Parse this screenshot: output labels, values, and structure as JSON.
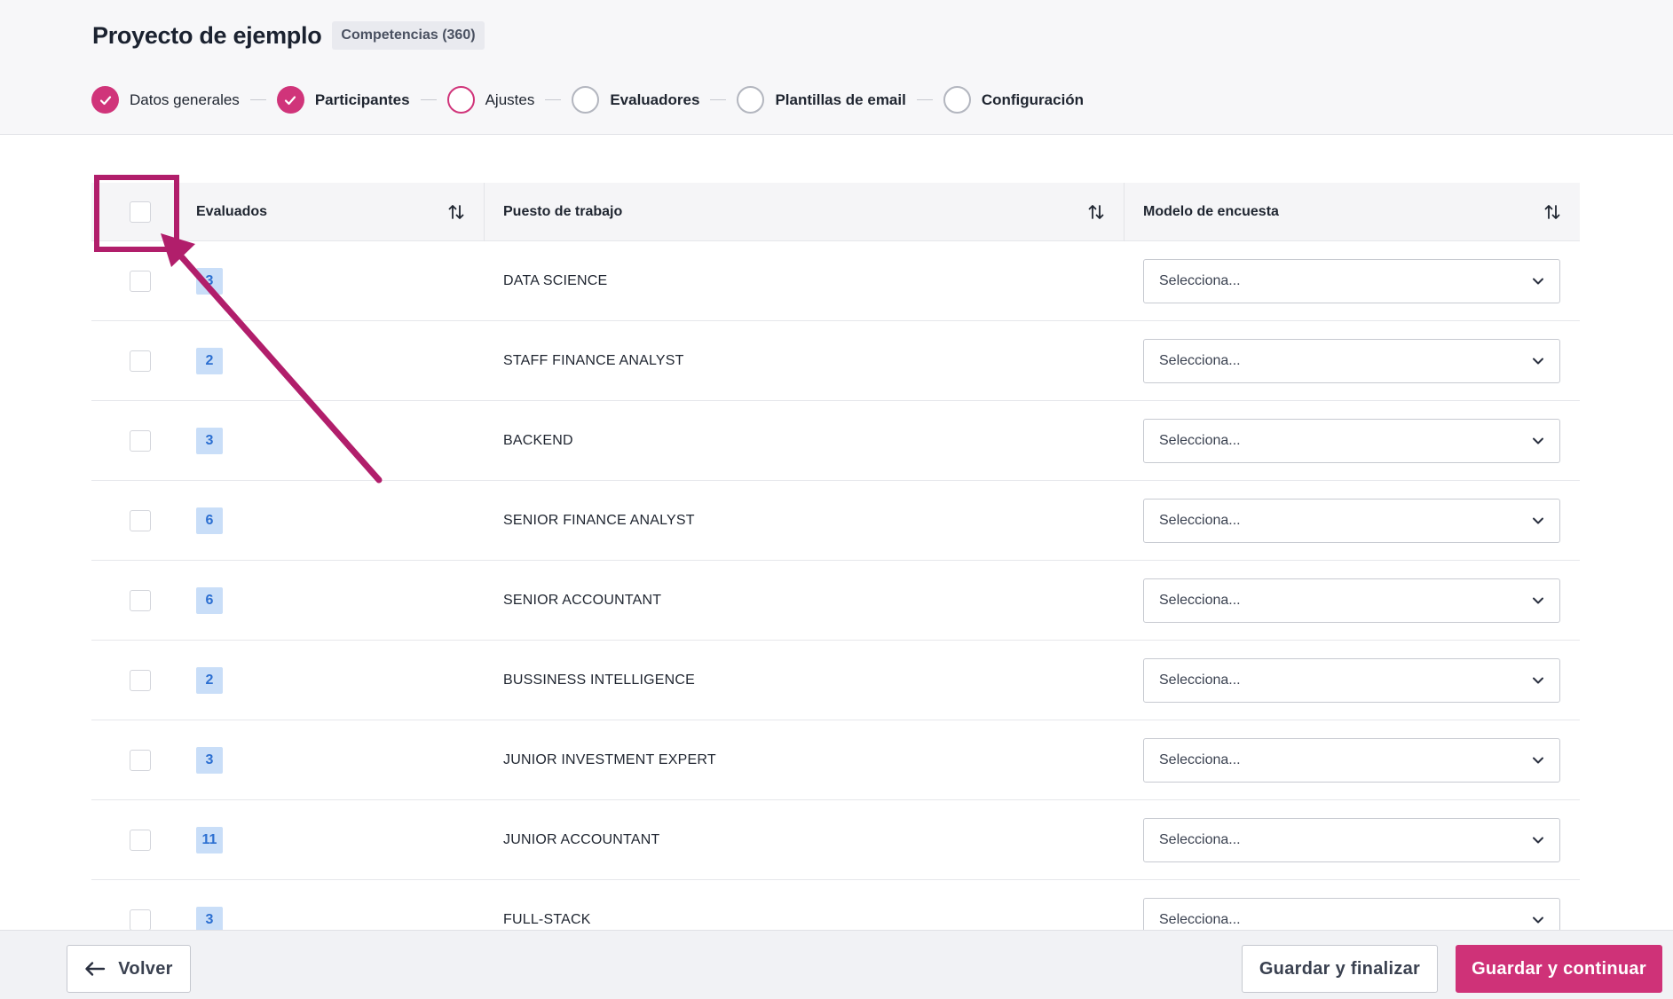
{
  "project": {
    "title": "Proyecto de ejemplo",
    "type_badge": "Competencias (360)"
  },
  "stepper": {
    "steps": [
      {
        "label": "Datos generales",
        "state": "done"
      },
      {
        "label": "Participantes",
        "state": "done"
      },
      {
        "label": "Ajustes",
        "state": "current"
      },
      {
        "label": "Evaluadores",
        "state": "pending"
      },
      {
        "label": "Plantillas de email",
        "state": "pending"
      },
      {
        "label": "Configuración",
        "state": "pending"
      }
    ]
  },
  "table": {
    "headers": {
      "evaluados": "Evaluados",
      "puesto": "Puesto de trabajo",
      "modelo": "Modelo de encuesta"
    },
    "rows": [
      {
        "count": "3",
        "puesto": "DATA SCIENCE",
        "modelo": "Selecciona..."
      },
      {
        "count": "2",
        "puesto": "STAFF FINANCE ANALYST",
        "modelo": "Selecciona..."
      },
      {
        "count": "3",
        "puesto": "BACKEND",
        "modelo": "Selecciona..."
      },
      {
        "count": "6",
        "puesto": "SENIOR FINANCE ANALYST",
        "modelo": "Selecciona..."
      },
      {
        "count": "6",
        "puesto": "SENIOR ACCOUNTANT",
        "modelo": "Selecciona..."
      },
      {
        "count": "2",
        "puesto": "BUSSINESS INTELLIGENCE",
        "modelo": "Selecciona..."
      },
      {
        "count": "3",
        "puesto": "JUNIOR INVESTMENT EXPERT",
        "modelo": "Selecciona..."
      },
      {
        "count": "11",
        "puesto": "JUNIOR ACCOUNTANT",
        "modelo": "Selecciona..."
      },
      {
        "count": "3",
        "puesto": "FULL-STACK",
        "modelo": "Selecciona..."
      }
    ]
  },
  "footer": {
    "back_label": "Volver",
    "save_finish_label": "Guardar y finalizar",
    "save_continue_label": "Guardar y continuar"
  },
  "colors": {
    "accent": "#cf3278",
    "annotation": "#b11e6b",
    "badge_bg": "#c9def8",
    "badge_text": "#2c6fd1"
  },
  "icons": [
    "check-icon",
    "sort-icon",
    "chevron-down-icon",
    "arrow-left-icon"
  ]
}
